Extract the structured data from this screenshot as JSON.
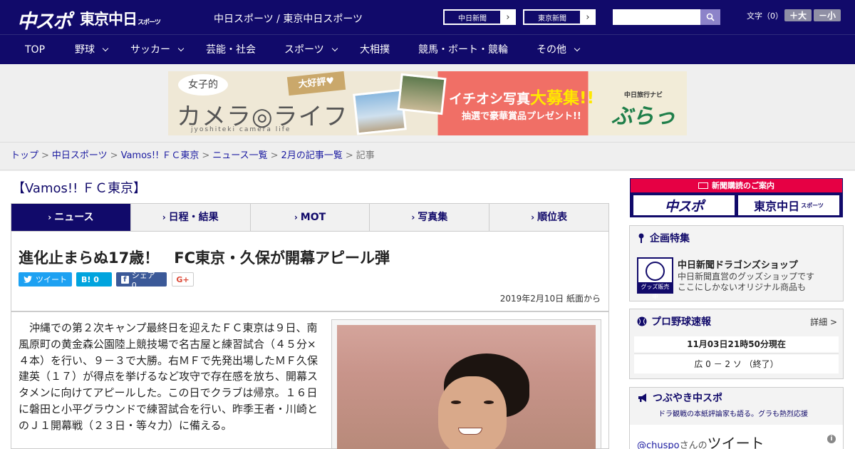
{
  "header": {
    "logo_chuspo": "中スポ",
    "logo_tokyo": "東京中日",
    "logo_tokyo_small": "スポーツ",
    "site_names": "中日スポーツ / 東京中日スポーツ",
    "btn_chunichi": "中日新聞",
    "btn_tokyo": "東京新聞",
    "search_placeholder": "",
    "font_label": "文字（0）",
    "font_up": "＋大",
    "font_down": "－小"
  },
  "nav": {
    "items": [
      "TOP",
      "野球",
      "サッカー",
      "芸能・社会",
      "スポーツ",
      "大相撲",
      "競馬・ボート・競輪",
      "その他"
    ]
  },
  "banner": {
    "joshi": "女子的",
    "title": "カメラ◎ライフ",
    "sub": "jyoshiteki camera life",
    "tag": "大好評♥",
    "headline_pre": "イチオシ写真",
    "headline_em": "大募集!!",
    "prize": "抽選で豪華賞品プレゼント!!",
    "navi": "中日旅行ナビ",
    "brand": "ぶらっ人"
  },
  "breadcrumb": [
    "トップ",
    "中日スポーツ",
    "Vamos!! ＦＣ東京",
    "ニュース一覧",
    "2月の記事一覧",
    "記事"
  ],
  "section_title": "【Vamos!! ＦＣ東京】",
  "tabs": [
    "ニュース",
    "日程・結果",
    "MOT",
    "写真集",
    "順位表"
  ],
  "article": {
    "title": "進化止まらぬ17歳！　FC東京・久保が開幕アピール弾",
    "share_tweet": "ツイート",
    "share_hatena": "B! 0",
    "share_fb": "シェア 0",
    "share_gplus": "G+",
    "date": "2019年2月10日 紙面から",
    "body": "　沖縄での第２次キャンプ最終日を迎えたＦＣ東京は９日、南風原町の黄金森公園陸上競技場で名古屋と練習試合（４５分×４本）を行い、９－３で大勝。右ＭＦで先発出場したＭＦ久保建英（１７）が得点を挙げるなど攻守で存在感を放ち、開幕スタメンに向けてアピールした。この日でクラブは帰京。１６日に磐田と小平グラウンドで練習試合を行い、昨季王者・川崎とのＪ１開幕戦（２３日・等々力）に備える。"
  },
  "sidebar": {
    "subscribe_head": "新聞購読のご案内",
    "subscribe_a": "中スポ",
    "subscribe_b": "東京中日",
    "subscribe_b_small": "スポーツ",
    "feature_head": "企画特集",
    "shop_logo_label": "グッズ販売中",
    "shop_title": "中日新聞ドラゴンズショップ",
    "shop_desc1": "中日新聞直営のグッズショップです",
    "shop_desc2": "ここにしかないオリジナル商品も",
    "baseball_head": "プロ野球速報",
    "baseball_more": "詳細 >",
    "baseball_time": "11月03日21時50分現在",
    "baseball_score": "広 0 － 2 ソ （終了）",
    "tweet_head": "つぶやき中スポ",
    "tweet_sub": "ドラ観戦の本紙評論家も語る。グラも熱烈応援",
    "tweet_handle": "@chuspo",
    "tweet_handle_suffix": "さんの",
    "tweet_word": "ツイート",
    "tweet_info": "i"
  },
  "colors": {
    "brand_navy": "#110a6a",
    "accent_red": "#e60044",
    "link_blue": "#1a1aa0"
  }
}
